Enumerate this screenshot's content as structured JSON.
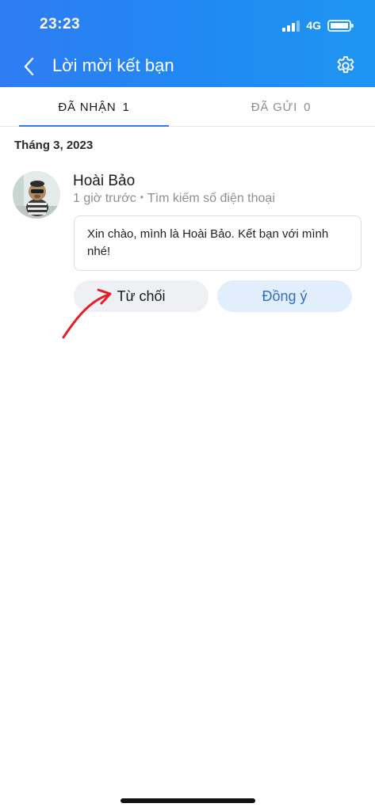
{
  "status_bar": {
    "time": "23:23",
    "network": "4G"
  },
  "nav": {
    "title": "Lời mời kết bạn",
    "back_icon": "chevron-left-icon",
    "settings_icon": "gear-icon"
  },
  "tabs": [
    {
      "label": "ĐÃ NHẬN",
      "count": "1",
      "active": true
    },
    {
      "label": "ĐÃ GỬI",
      "count": "0",
      "active": false
    }
  ],
  "section": {
    "date": "Tháng 3, 2023"
  },
  "request": {
    "name": "Hoài Bảo",
    "time": "1 giờ trước",
    "separator": "•",
    "source": "Tìm kiếm số điện thoại",
    "message": "Xin chào, mình là Hoài Bảo. Kết bạn với mình nhé!",
    "decline_label": "Từ chối",
    "accept_label": "Đồng ý"
  },
  "colors": {
    "header": "#2f7cf2",
    "accent": "#2f7cf2",
    "accept_text": "#2f6fd0",
    "annotation": "#e0202a"
  }
}
